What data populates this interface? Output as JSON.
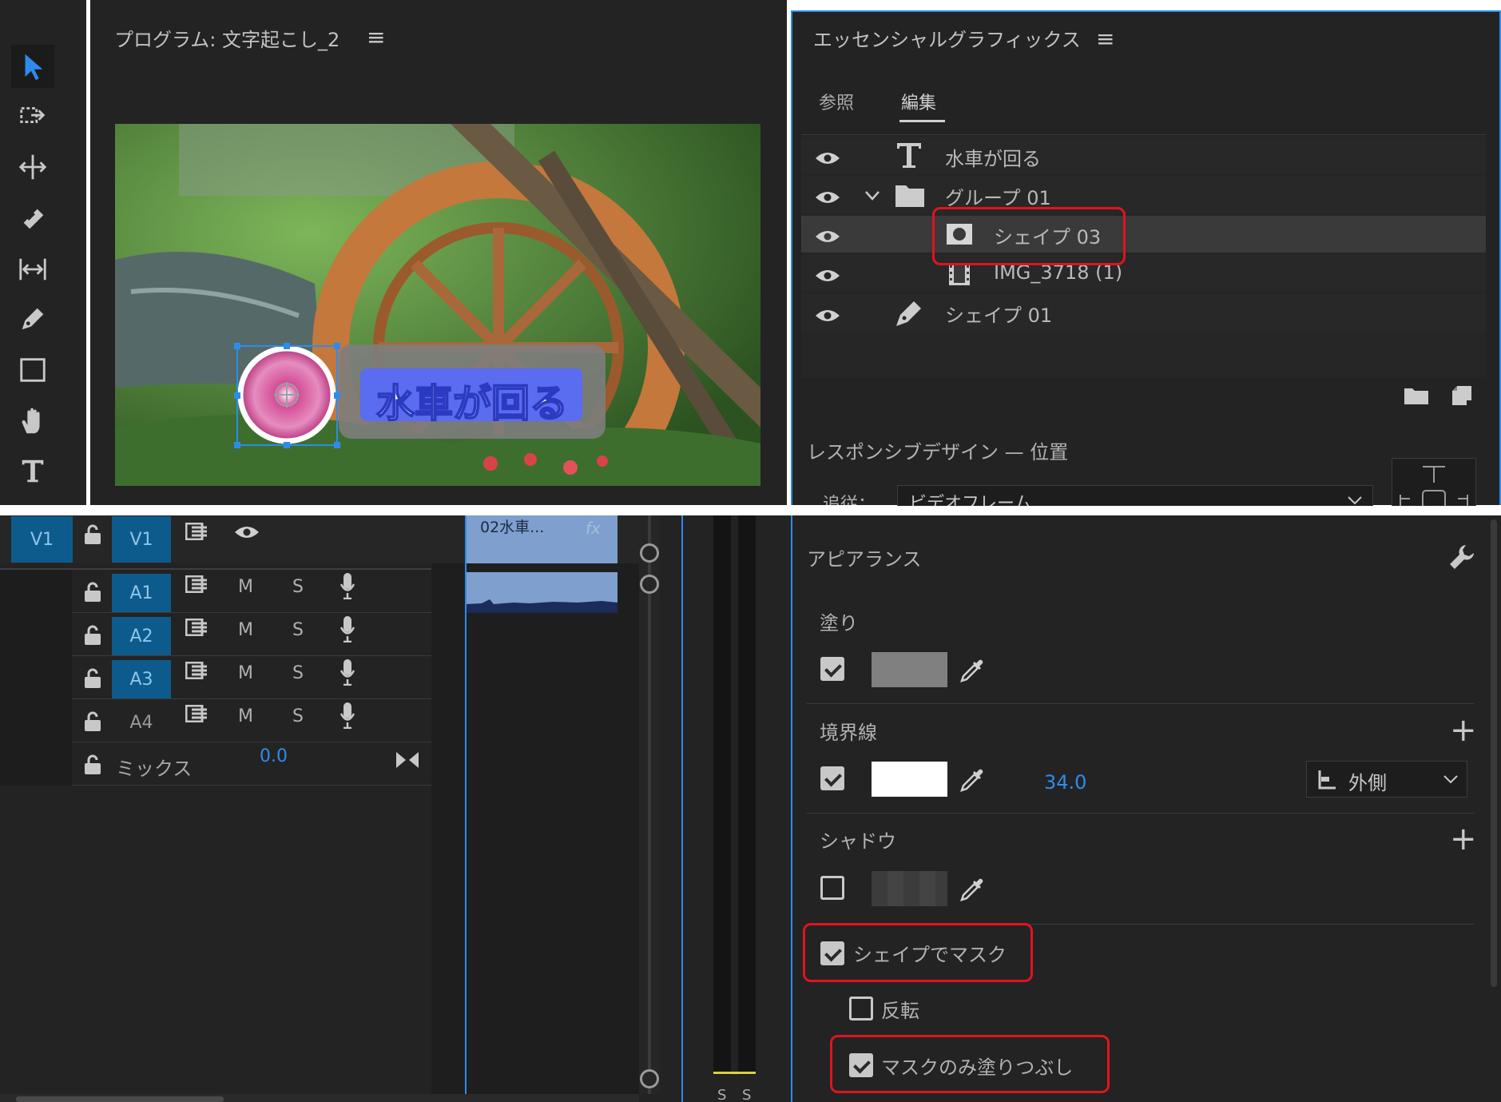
{
  "program": {
    "title": "プログラム: 文字起こし_2",
    "overlay_text": "水車が回る"
  },
  "essential": {
    "title": "エッセンシャルグラフィックス",
    "tabs": [
      {
        "label": "参照",
        "active": false
      },
      {
        "label": "編集",
        "active": true
      }
    ],
    "layers": [
      {
        "label": "水車が回る",
        "icon": "text-layer-icon"
      },
      {
        "label": "グループ 01",
        "icon": "folder-icon"
      },
      {
        "label": "シェイプ 03",
        "icon": "mask-shape-icon",
        "selected": true
      },
      {
        "label": "IMG_3718 (1)",
        "icon": "film-icon"
      },
      {
        "label": "シェイプ 01",
        "icon": "pen-icon"
      }
    ],
    "responsive_label": "レスポンシブデザイン — 位置",
    "follow_label": "追従：",
    "follow_value": "ビデオフレーム"
  },
  "timeline": {
    "source_track": "V1",
    "target_track": "V1",
    "clip_label": "02水車...",
    "clip_fx": "fx",
    "audio_tracks": [
      "A1",
      "A2",
      "A3",
      "A4"
    ],
    "mute_label": "M",
    "solo_label": "S",
    "mix_label": "ミックス",
    "mix_value": "0.0",
    "meter_labels": [
      "S",
      "S"
    ]
  },
  "appearance": {
    "title": "アピアランス",
    "fill_label": "塗り",
    "fill_checked": true,
    "fill_color": "#808080",
    "stroke_label": "境界線",
    "stroke_checked": true,
    "stroke_color": "#ffffff",
    "stroke_width": "34.0",
    "stroke_position": "外側",
    "shadow_label": "シャドウ",
    "shadow_checked": false,
    "mask_with_shape": "シェイプでマスク",
    "mask_with_shape_checked": true,
    "invert_label": "反転",
    "invert_checked": false,
    "mask_fill_only": "マスクのみ塗りつぶし",
    "mask_fill_only_checked": true
  },
  "colors": {
    "panel_bg": "#232323",
    "accent_blue": "#2d8ceb",
    "highlight_red": "#e0141e",
    "track_blue": "#0d5b8c"
  }
}
